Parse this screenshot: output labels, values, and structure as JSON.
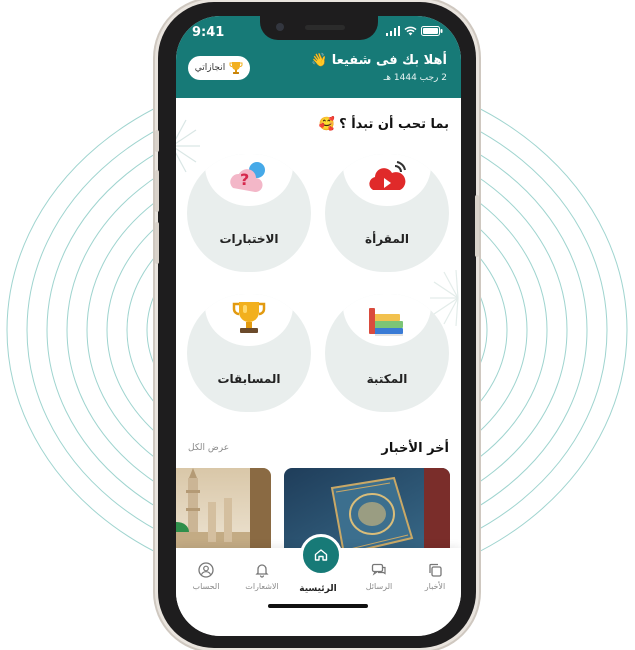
{
  "status_bar": {
    "time": "9:41"
  },
  "header": {
    "greeting": "أهلا بك فى شفيعا 👋",
    "date": "2 رجب 1444 هـ",
    "achievements_label": "انجازاتي"
  },
  "home": {
    "section_title": "بما تحب أن تبدأ ؟ 🥰",
    "tiles": [
      {
        "label": "المقرأة",
        "icon": "video-play-icon"
      },
      {
        "label": "الاختبارات",
        "icon": "quiz-question-icon"
      },
      {
        "label": "المكتبة",
        "icon": "books-icon"
      },
      {
        "label": "المسابقات",
        "icon": "trophy-icon"
      }
    ]
  },
  "news": {
    "title": "أخر الأخبار",
    "view_all": "عرض الكل"
  },
  "tabs": {
    "news": "الأخبار",
    "messages": "الرسائل",
    "home": "الرئيسية",
    "notifications": "الاشعارات",
    "account": "الحساب"
  },
  "colors": {
    "brand": "#177a77",
    "tile_bg": "#e9eeed"
  }
}
